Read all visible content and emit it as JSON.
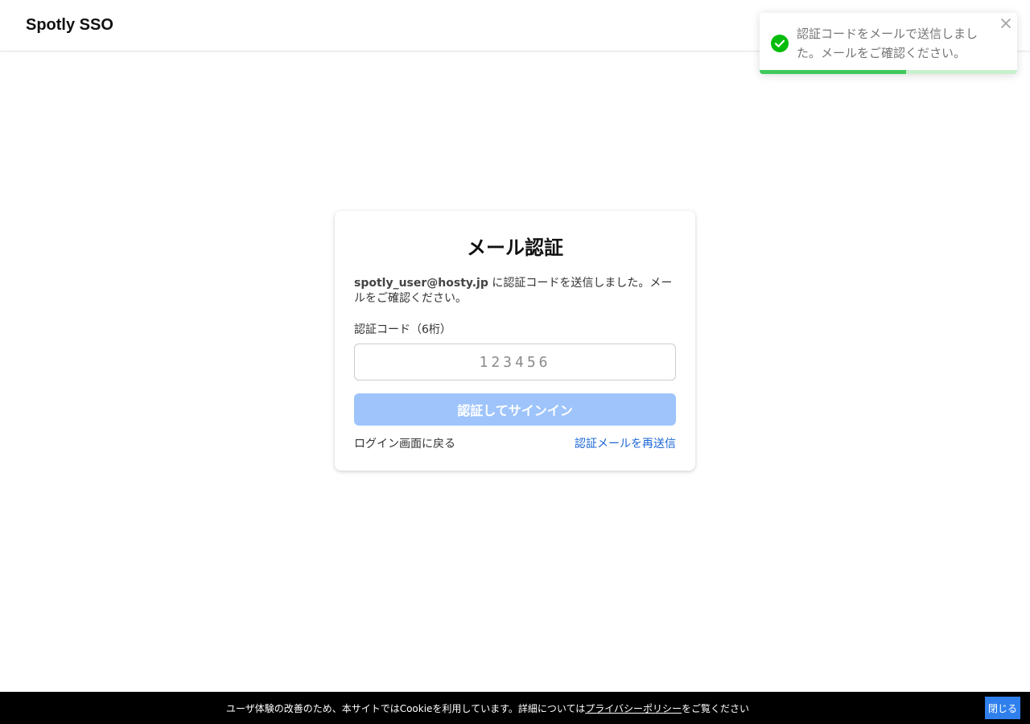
{
  "header": {
    "logo": "Spotly SSO"
  },
  "toast": {
    "message": "認証コードをメールで送信しました。メールをご確認ください。",
    "icon": "check-circle-icon",
    "close_icon": "close-icon",
    "progress": 0.57,
    "accent": "#3ec95a"
  },
  "card": {
    "title": "メール認証",
    "email": "spotly_user@hosty.jp",
    "description_suffix": " に認証コードを送信しました。メールをご確認ください。",
    "code_label": "認証コード（6桁）",
    "code_value": "",
    "code_placeholder": "123456",
    "submit_label": "認証してサインイン",
    "back_link": "ログイン画面に戻る",
    "resend_link": "認証メールを再送信"
  },
  "cookie": {
    "text_before": "ユーザ体験の改善のため、本サイトではCookieを利用しています。詳細については",
    "policy_link": "プライバシーポリシー",
    "text_after": "をご覧ください",
    "close_label": "閉じる"
  },
  "colors": {
    "primary_disabled": "#9ec4fb",
    "link": "#1a66d6",
    "cookie_button": "#2f80ed"
  }
}
